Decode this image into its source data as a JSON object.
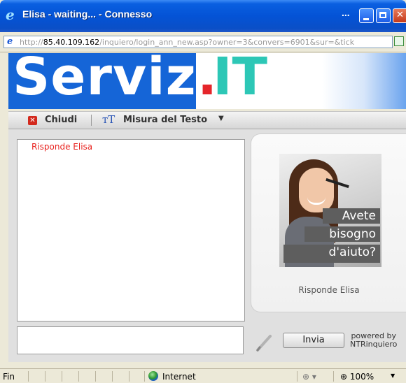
{
  "window": {
    "title": "Elisa - waiting... - Connesso",
    "ellipsis": "...",
    "url_scheme_path_prefix": "http://",
    "url_host": "85.40.109.162",
    "url_path": "/inquiero/login_ann_new.asp?owner=3&convers=6901&sur=&tick"
  },
  "banner": {
    "word": "Servizi",
    "dot": ".",
    "suffix": "IT",
    "colors": {
      "blue": "#1565d7",
      "red": "#e5252a",
      "teal": "#2dc7b6"
    }
  },
  "toolbar": {
    "close_label": "Chiudi",
    "close_icon": "close-icon",
    "text_size_label": "Misura del Testo",
    "text_size_icon": "text-size-icon",
    "text_size_glyph": "ᴛT",
    "dropdown_arrow": "▼"
  },
  "chat": {
    "messages": [
      "Risponde Elisa"
    ],
    "message_color": "#e8231f"
  },
  "agent": {
    "photo_lines": [
      "Avete",
      "bisogno",
      "d'aiuto?"
    ],
    "caption": "Risponde Elisa"
  },
  "composer": {
    "input_value": "",
    "send_label": "Invia",
    "powered_line1": "powered by",
    "powered_line2": "NTRinquiero"
  },
  "statusbar": {
    "status": "Fin",
    "zone": "Internet",
    "lock_glyph": "🔒",
    "zoom": "100%",
    "zoom_prefix": "⊕"
  }
}
